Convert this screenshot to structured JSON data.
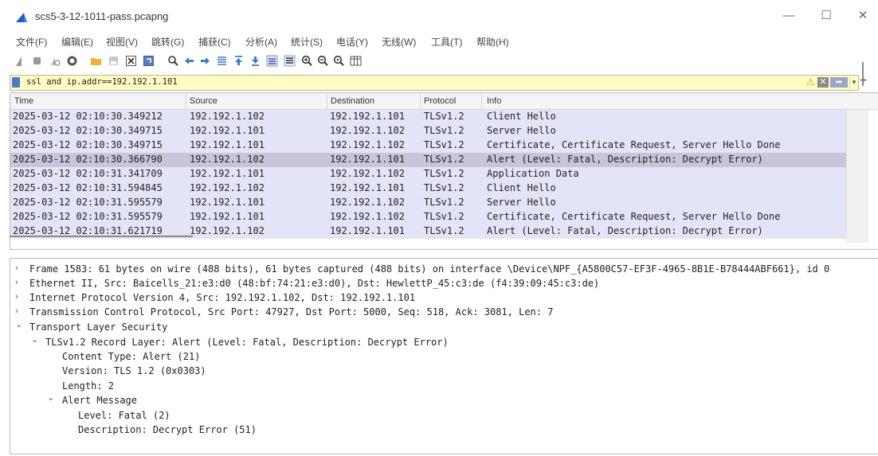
{
  "window": {
    "title": "scs5-3-12-1011-pass.pcapng",
    "minimize": "—",
    "maximize": "☐",
    "close": "✕"
  },
  "menu": [
    "文件(F)",
    "编辑(E)",
    "视图(V)",
    "跳转(G)",
    "捕获(C)",
    "分析(A)",
    "统计(S)",
    "电话(Y)",
    "无线(W)",
    "工具(T)",
    "帮助(H)"
  ],
  "filter": {
    "value": "ssl and ip.addr==192.192.1.101",
    "warn": "⚠",
    "clear": "✕",
    "apply": "➡",
    "dropdown": "▾",
    "add": "+"
  },
  "packet_list": {
    "columns": [
      "Time",
      "Source",
      "Destination",
      "Protocol",
      "Info"
    ],
    "rows": [
      {
        "time": "2025-03-12 02:10:30.349212",
        "src": "192.192.1.102",
        "dst": "192.192.1.101",
        "proto": "TLSv1.2",
        "info": "Client Hello"
      },
      {
        "time": "2025-03-12 02:10:30.349715",
        "src": "192.192.1.101",
        "dst": "192.192.1.102",
        "proto": "TLSv1.2",
        "info": "Server Hello"
      },
      {
        "time": "2025-03-12 02:10:30.349715",
        "src": "192.192.1.101",
        "dst": "192.192.1.102",
        "proto": "TLSv1.2",
        "info": "Certificate, Certificate Request, Server Hello Done"
      },
      {
        "time": "2025-03-12 02:10:30.366790",
        "src": "192.192.1.102",
        "dst": "192.192.1.101",
        "proto": "TLSv1.2",
        "info": "Alert (Level: Fatal, Description: Decrypt Error)"
      },
      {
        "time": "2025-03-12 02:10:31.341709",
        "src": "192.192.1.101",
        "dst": "192.192.1.102",
        "proto": "TLSv1.2",
        "info": "Application Data"
      },
      {
        "time": "2025-03-12 02:10:31.594845",
        "src": "192.192.1.102",
        "dst": "192.192.1.101",
        "proto": "TLSv1.2",
        "info": "Client Hello"
      },
      {
        "time": "2025-03-12 02:10:31.595579",
        "src": "192.192.1.101",
        "dst": "192.192.1.102",
        "proto": "TLSv1.2",
        "info": "Server Hello"
      },
      {
        "time": "2025-03-12 02:10:31.595579",
        "src": "192.192.1.101",
        "dst": "192.192.1.102",
        "proto": "TLSv1.2",
        "info": "Certificate, Certificate Request, Server Hello Done"
      },
      {
        "time": "2025-03-12 02:10:31.621719",
        "src": "192.192.1.102",
        "dst": "192.192.1.101",
        "proto": "TLSv1.2",
        "info": "Alert (Level: Fatal, Description: Decrypt Error)"
      }
    ],
    "selected_row": 3
  },
  "details": {
    "frame": "Frame 1583: 61 bytes on wire (488 bits), 61 bytes captured (488 bits) on interface \\Device\\NPF_{A5800C57-EF3F-4965-8B1E-B78444ABF661}, id 0",
    "ethernet": "Ethernet II, Src: Baicells_21:e3:d0 (48:bf:74:21:e3:d0), Dst: HewlettP_45:c3:de (f4:39:09:45:c3:de)",
    "ip": "Internet Protocol Version 4, Src: 192.192.1.102, Dst: 192.192.1.101",
    "tcp": "Transmission Control Protocol, Src Port: 47927, Dst Port: 5000, Seq: 518, Ack: 3081, Len: 7",
    "tls": "Transport Layer Security",
    "record": "TLSv1.2 Record Layer: Alert (Level: Fatal, Description: Decrypt Error)",
    "content_type": "Content Type: Alert (21)",
    "version": "Version: TLS 1.2 (0x0303)",
    "length": "Length: 2",
    "alert_msg": "Alert Message",
    "level": "Level: Fatal (2)",
    "description": "Description: Decrypt Error (51)",
    "collapsed_arrow": "›",
    "expanded_arrow": "⌄"
  },
  "colors": {
    "row_bg": "#e4e4f8",
    "row_selected_bg": "#c6c5d9",
    "filter_bg": "#fffcc1"
  }
}
